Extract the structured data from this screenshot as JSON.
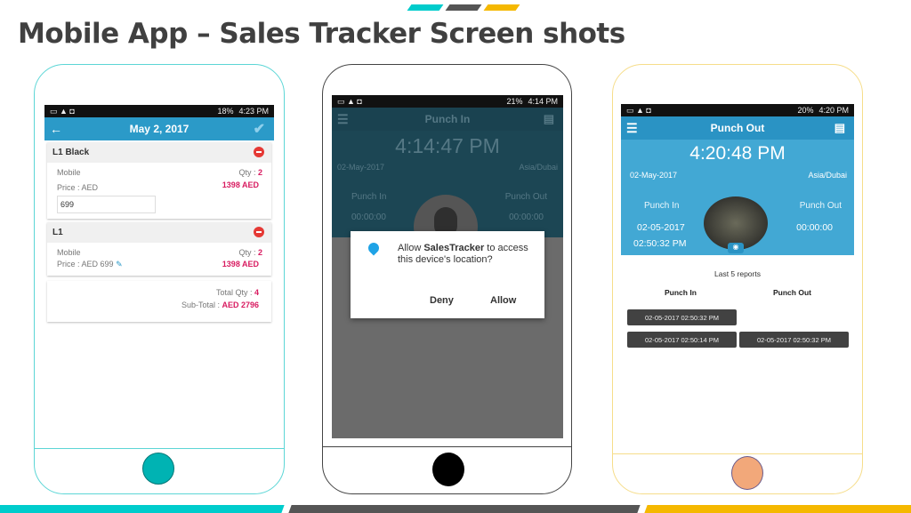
{
  "slide": {
    "title": "Mobile App – Sales Tracker Screen shots",
    "colors": {
      "cyan": "#00CCCC",
      "gray": "#555555",
      "yellow": "#F5B800"
    }
  },
  "phone1": {
    "status": {
      "battery": "18%",
      "time": "4:23 PM"
    },
    "appbar": {
      "title": "May 2, 2017",
      "back_icon": "arrow-left-icon",
      "check_icon": "check-icon"
    },
    "items": [
      {
        "name": "L1 Black",
        "type": "Mobile",
        "qty_label": "Qty : ",
        "qty": "2",
        "price_label": "Price : AED",
        "price_input": "699",
        "total": "1398  AED"
      },
      {
        "name": "L1",
        "type": "Mobile",
        "qty_label": "Qty : ",
        "qty": "2",
        "price_label": "Price : AED  699",
        "total": "1398  AED"
      }
    ],
    "summary": {
      "total_qty_label": "Total Qty : ",
      "total_qty": "4",
      "subtotal_label": "Sub-Total : ",
      "subtotal": "AED  2796"
    }
  },
  "phone2": {
    "status": {
      "battery": "21%",
      "time": "4:14 PM"
    },
    "appbar": {
      "title": "Punch In"
    },
    "clock": "4:14:47 PM",
    "date": "02-May-2017",
    "timezone": "Asia/Dubai",
    "punch_in_label": "Punch In",
    "punch_in_value": "00:00:00",
    "punch_out_label": "Punch Out",
    "punch_out_value": "00:00:00",
    "dialog": {
      "pre": "Allow ",
      "app": "SalesTracker",
      "post": " to access this device's location?",
      "deny": "Deny",
      "allow": "Allow"
    }
  },
  "phone3": {
    "status": {
      "battery": "20%",
      "time": "4:20 PM"
    },
    "appbar": {
      "title": "Punch Out"
    },
    "clock": "4:20:48 PM",
    "date": "02-May-2017",
    "timezone": "Asia/Dubai",
    "punch_in_label": "Punch In",
    "punch_in_date": "02-05-2017",
    "punch_in_time": "02:50:32 PM",
    "punch_out_label": "Punch Out",
    "punch_out_value": "00:00:00",
    "reports_title": "Last 5 reports",
    "col_in": "Punch In",
    "col_out": "Punch Out",
    "reports": [
      {
        "in": "02-05-2017 02:50:32 PM",
        "out": ""
      },
      {
        "in": "02-05-2017 02:50:14 PM",
        "out": "02-05-2017 02:50:32 PM"
      }
    ]
  }
}
